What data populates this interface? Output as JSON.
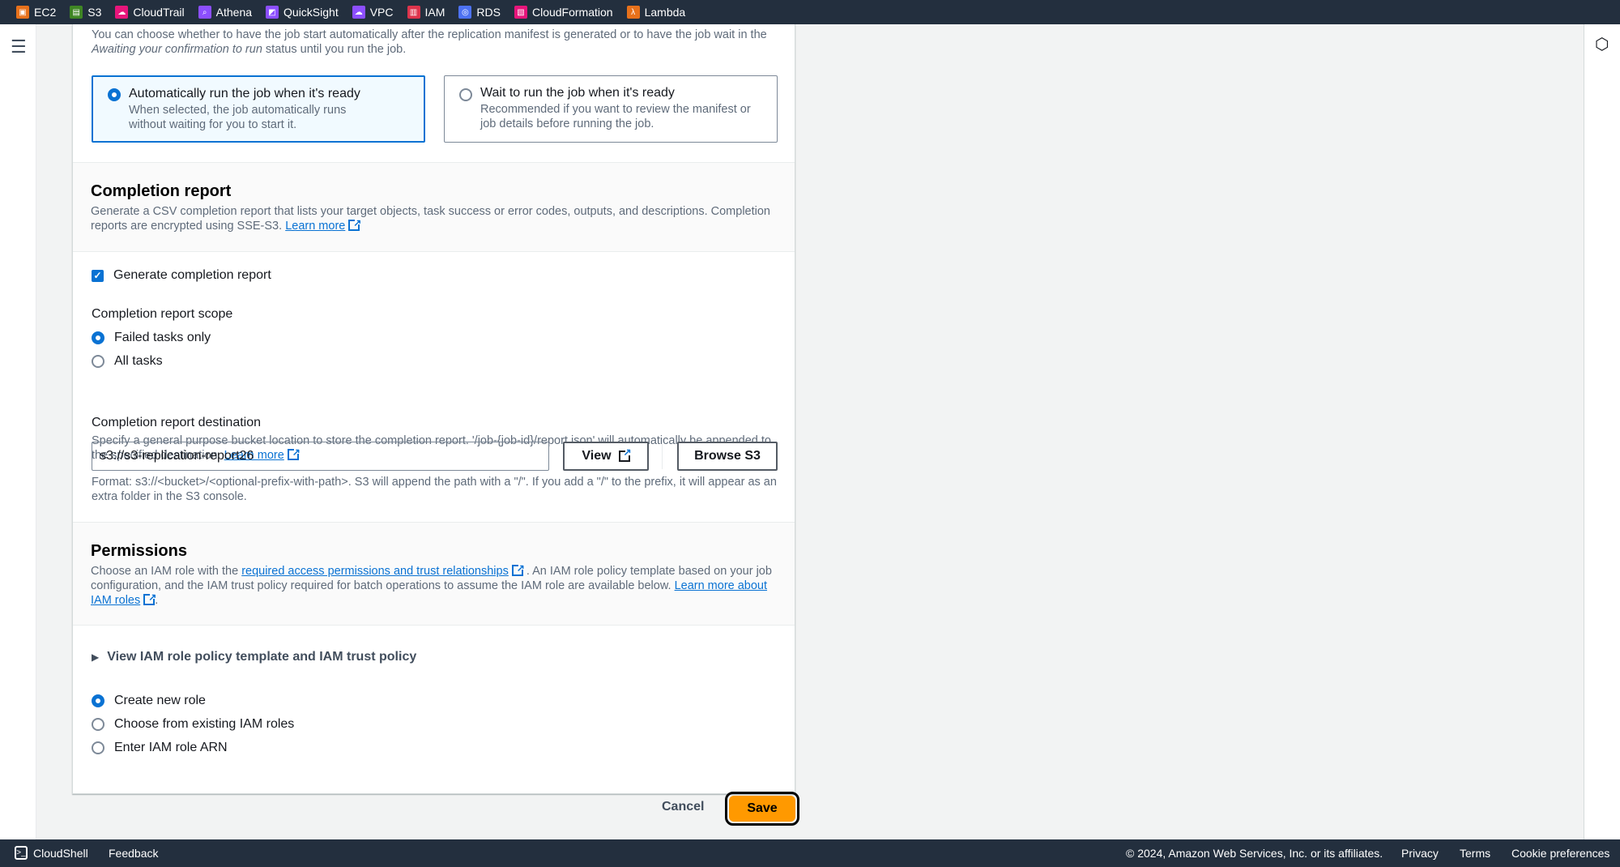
{
  "topnav": {
    "services": [
      {
        "label": "EC2",
        "color": "#e7711b"
      },
      {
        "label": "S3",
        "color": "#3f8624"
      },
      {
        "label": "CloudTrail",
        "color": "#e7157b"
      },
      {
        "label": "Athena",
        "color": "#8c4fff"
      },
      {
        "label": "QuickSight",
        "color": "#8c4fff"
      },
      {
        "label": "VPC",
        "color": "#8c4fff"
      },
      {
        "label": "IAM",
        "color": "#dd344c"
      },
      {
        "label": "RDS",
        "color": "#4d72f3"
      },
      {
        "label": "CloudFormation",
        "color": "#e7157b"
      },
      {
        "label": "Lambda",
        "color": "#e7711b"
      }
    ]
  },
  "run": {
    "intro_1": "You can choose whether to have the job start automatically after the replication manifest is generated or to have the job wait in the",
    "intro_em": "Awaiting your confirmation to run",
    "intro_2": " status until you run the job.",
    "options": [
      {
        "label": "Automatically run the job when it's ready",
        "desc": "When selected, the job automatically runs without waiting for you to start it.",
        "selected": true
      },
      {
        "label": "Wait to run the job when it's ready",
        "desc": "Recommended if you want to review the manifest or job details before running the job.",
        "selected": false
      }
    ]
  },
  "completion": {
    "title": "Completion report",
    "desc": "Generate a CSV completion report that lists your target objects, task success or error codes, outputs, and descriptions. Completion reports are encrypted using SSE-S3. ",
    "learn_more": "Learn more",
    "generate_label": "Generate completion report",
    "generate_checked": true,
    "scope_label": "Completion report scope",
    "scope_options": [
      {
        "label": "Failed tasks only",
        "selected": true
      },
      {
        "label": "All tasks",
        "selected": false
      }
    ],
    "dest_label": "Completion report destination",
    "dest_desc": "Specify a general purpose bucket location to store the completion report. '/job-{job-id}/report.json' will automatically be appended to the specified destination. ",
    "dest_learn_more": "Learn more",
    "dest_value": "s3://s3-replication-report26",
    "view_label": "View",
    "browse_label": "Browse S3",
    "format_hint": "Format: s3://<bucket>/<optional-prefix-with-path>. S3 will append the path with a \"/\". If you add a \"/\" to the prefix, it will appear as an extra folder in the S3 console."
  },
  "permissions": {
    "title": "Permissions",
    "desc_1": "Choose an IAM role with the ",
    "link_1": "required access permissions and trust relationships",
    "desc_2": " . An IAM role policy template based on your job configuration, and the IAM trust policy required for batch operations to assume the IAM role are available below. ",
    "link_2": "Learn more about IAM roles",
    "desc_3": ".",
    "expand_label": "View IAM role policy template and IAM trust policy",
    "role_options": [
      {
        "label": "Create new role",
        "selected": true
      },
      {
        "label": "Choose from existing IAM roles",
        "selected": false
      },
      {
        "label": "Enter IAM role ARN",
        "selected": false
      }
    ]
  },
  "actions": {
    "cancel": "Cancel",
    "save": "Save"
  },
  "footer": {
    "cloudshell": "CloudShell",
    "feedback": "Feedback",
    "copyright": "© 2024, Amazon Web Services, Inc. or its affiliates.",
    "privacy": "Privacy",
    "terms": "Terms",
    "cookies": "Cookie preferences"
  }
}
